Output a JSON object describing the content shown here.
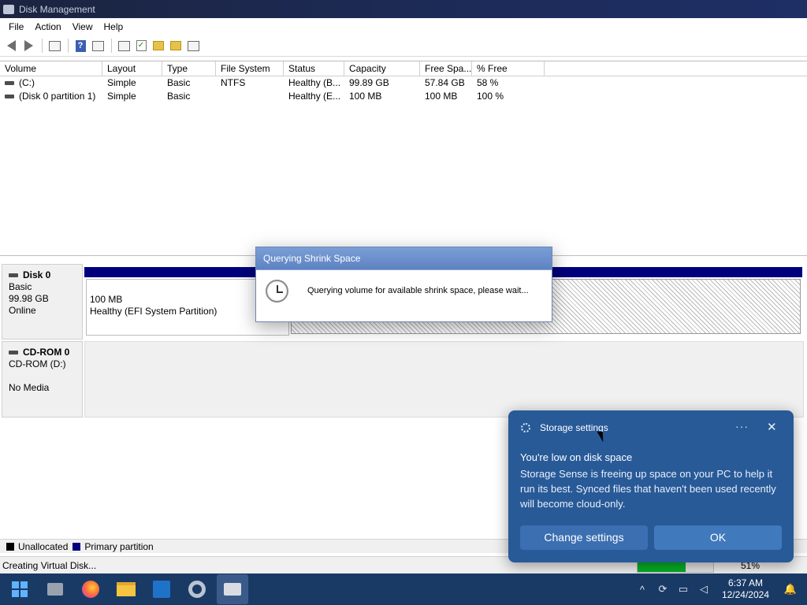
{
  "window": {
    "title": "Disk Management"
  },
  "menu": [
    "File",
    "Action",
    "View",
    "Help"
  ],
  "volume_table": {
    "columns": [
      "Volume",
      "Layout",
      "Type",
      "File System",
      "Status",
      "Capacity",
      "Free Spa...",
      "% Free"
    ],
    "rows": [
      [
        "(C:)",
        "Simple",
        "Basic",
        "NTFS",
        "Healthy (B...",
        "99.89 GB",
        "57.84 GB",
        "58 %"
      ],
      [
        "(Disk 0 partition 1)",
        "Simple",
        "Basic",
        "",
        "Healthy (E...",
        "100 MB",
        "100 MB",
        "100 %"
      ]
    ]
  },
  "disks": {
    "disk0": {
      "name": "Disk 0",
      "type": "Basic",
      "size": "99.98 GB",
      "state": "Online",
      "partition": {
        "size": "100 MB",
        "status": "Healthy (EFI System Partition)"
      }
    },
    "cdrom": {
      "name": "CD-ROM 0",
      "type": "CD-ROM (D:)",
      "media": "No Media"
    }
  },
  "legend": {
    "unallocated": "Unallocated",
    "primary": "Primary partition"
  },
  "statusbar": {
    "text": "Creating Virtual Disk...",
    "percent": "51%",
    "progress_fraction": 0.64
  },
  "dialog": {
    "title": "Querying Shrink Space",
    "message": "Querying volume for available shrink space, please wait..."
  },
  "toast": {
    "app": "Storage settings",
    "more": "···",
    "close": "✕",
    "title": "You're low on disk space",
    "body": "Storage Sense is freeing up space on your PC to help it run its best. Synced files that haven't been used recently will become cloud-only.",
    "change_button": "Change settings",
    "ok_button": "OK"
  },
  "taskbar": {
    "time": "6:37 AM",
    "date": "12/24/2024"
  },
  "colors": {
    "primary_partition": "#00007c",
    "toast_bg": "#285a98",
    "taskbar_bg": "#1a3a66",
    "progress": "#06b025"
  },
  "icons": [
    "back-icon",
    "forward-icon",
    "properties-icon",
    "help-icon",
    "refresh-icon",
    "check-icon",
    "folder-up-icon",
    "folder-open-icon",
    "list-icon",
    "clock-icon",
    "gear-icon"
  ]
}
